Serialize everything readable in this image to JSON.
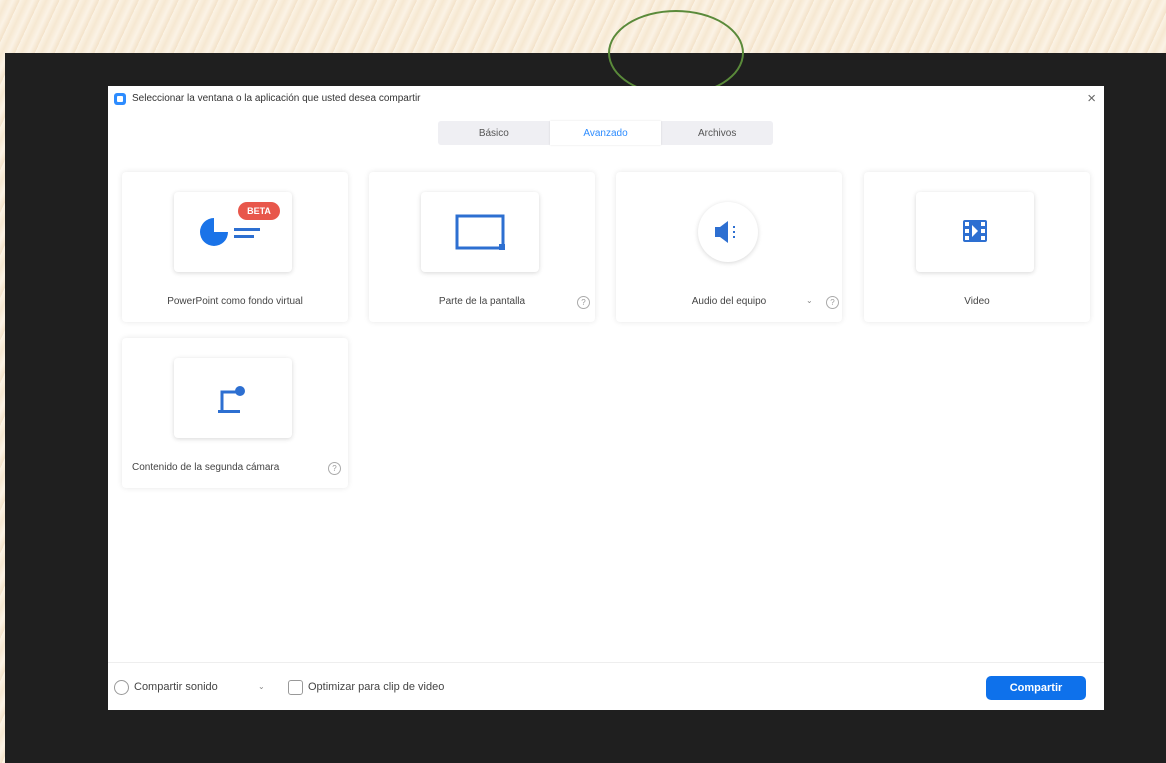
{
  "window": {
    "title": "Seleccionar la ventana o la aplicación que usted desea compartir",
    "close_glyph": "×"
  },
  "tabs": [
    {
      "label": "Básico",
      "active": false
    },
    {
      "label": "Avanzado",
      "active": true
    },
    {
      "label": "Archivos",
      "active": false
    }
  ],
  "options": [
    {
      "label": "PowerPoint como fondo virtual",
      "icon": "powerpoint-virtual-background-icon",
      "badge": "BETA"
    },
    {
      "label": "Parte de la pantalla",
      "icon": "screen-portion-icon",
      "help": "?"
    },
    {
      "label": "Audio del equipo",
      "icon": "computer-audio-icon",
      "dropdown": "⌄",
      "help": "?"
    },
    {
      "label": "Video",
      "icon": "video-file-icon"
    },
    {
      "label": "Contenido de la segunda cámara",
      "icon": "second-camera-icon",
      "help": "?"
    }
  ],
  "footer": {
    "share_sound_label": "Compartir sonido",
    "share_sound_dropdown": "⌄",
    "optimize_video_label": "Optimizar para clip de video",
    "share_button_label": "Compartir"
  },
  "colors": {
    "accent": "#0e71eb",
    "icon_blue": "#2d6fd1",
    "beta_badge": "#e8574b",
    "annotation": "#5a8a3a"
  }
}
